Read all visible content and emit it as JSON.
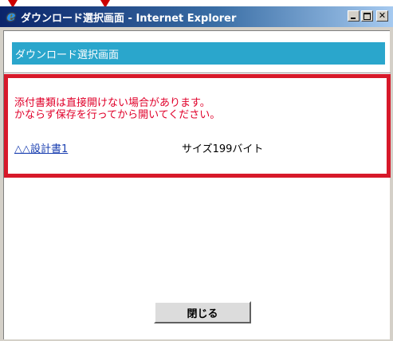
{
  "window": {
    "title": "ダウンロード選択画面 - Internet Explorer",
    "icon": "ie-icon",
    "buttons": {
      "minimize": "",
      "maximize": "",
      "close": "✕"
    }
  },
  "page": {
    "header": "ダウンロード選択画面",
    "warning_line1": "添付書類は直接開けない場合があります。",
    "warning_line2": "かならず保存を行ってから開いてください。",
    "file": {
      "name": "△△設計書1",
      "size": "サイズ199バイト"
    },
    "close_button": "閉じる"
  },
  "colors": {
    "titlebar": "#0a246a",
    "header_bar": "#2aa6cc",
    "highlight_border": "#d7192a",
    "warning_text": "#e0002a",
    "link": "#1a3fb0",
    "annotation_arrow": "#cc0000"
  }
}
